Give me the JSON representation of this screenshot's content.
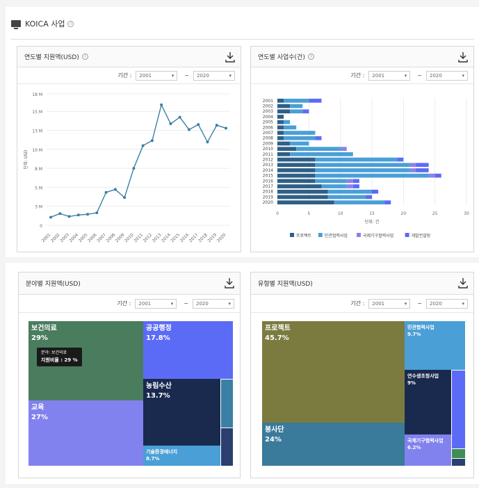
{
  "section": {
    "title": "KOICA 사업"
  },
  "period": {
    "label": "기간 :",
    "from": "2001",
    "to": "2020",
    "sep1": "~",
    "sep2": "~",
    "sep3": "−",
    "sep4": "−"
  },
  "panels": {
    "p1": "연도별 지원액(USD)",
    "p2": "연도별 사업수(건)",
    "p3": "분야별 지원액(USD)",
    "p4": "유형별 지원액(USD)"
  },
  "chart_data": [
    {
      "type": "line",
      "title": "연도별 지원액(USD)",
      "ylabel": "단위: USD",
      "categories": [
        "2001",
        "2002",
        "2003",
        "2004",
        "2005",
        "2006",
        "2007",
        "2008",
        "2009",
        "2010",
        "2011",
        "2012",
        "2013",
        "2014",
        "2015",
        "2016",
        "2017",
        "2018",
        "2019",
        "2020"
      ],
      "values": [
        1.1,
        1.6,
        1.2,
        1.4,
        1.5,
        1.7,
        4.5,
        4.9,
        3.8,
        7.8,
        10.9,
        11.6,
        16.5,
        13.9,
        14.8,
        13.1,
        13.8,
        11.4,
        13.7,
        13.3
      ],
      "yticks": [
        "0",
        "3 M",
        "5 M",
        "8 M",
        "10 M",
        "13 M",
        "15 M",
        "18 M"
      ],
      "ylim": [
        0,
        18
      ]
    },
    {
      "type": "bar",
      "title": "연도별 사업수(건)",
      "xlabel": "단위: 건",
      "categories": [
        "2001",
        "2002",
        "2003",
        "2004",
        "2005",
        "2006",
        "2007",
        "2008",
        "2009",
        "2010",
        "2011",
        "2012",
        "2013",
        "2014",
        "2015",
        "2016",
        "2017",
        "2018",
        "2019",
        "2020"
      ],
      "xticks": [
        "0",
        "5",
        "10",
        "15",
        "20",
        "25",
        "30"
      ],
      "xlim": [
        0,
        30
      ],
      "series": [
        {
          "name": "프로젝트",
          "color": "#2e5f86",
          "values": [
            1,
            2,
            2,
            1,
            1,
            1,
            1,
            1,
            2,
            3,
            2,
            6,
            6,
            6,
            6,
            6,
            7,
            8,
            8,
            9
          ]
        },
        {
          "name": "민관협력사업",
          "color": "#4a9fd6",
          "values": [
            4,
            2,
            2,
            0,
            1,
            2,
            5,
            5,
            3,
            7,
            10,
            13,
            15,
            15,
            18,
            5,
            4,
            7,
            6,
            8
          ]
        },
        {
          "name": "국제기구협력사업",
          "color": "#8b82ea",
          "values": [
            0,
            0,
            0,
            0,
            0,
            0,
            0,
            0,
            0,
            1,
            0,
            0,
            1,
            1,
            1,
            1,
            1,
            0,
            0,
            0
          ]
        },
        {
          "name": "개발컨설팅",
          "color": "#5c6bf5",
          "values": [
            2,
            0,
            1,
            0,
            0,
            0,
            0,
            1,
            0,
            0,
            0,
            1,
            2,
            2,
            1,
            1,
            1,
            1,
            1,
            1
          ]
        }
      ]
    },
    {
      "type": "treemap",
      "title": "분야별 지원액(USD)",
      "items": [
        {
          "name": "보건의료",
          "pct": "29%",
          "color": "#4a7c5e"
        },
        {
          "name": "공공행정",
          "pct": "17.8%",
          "color": "#5c6bf5"
        },
        {
          "name": "교육",
          "pct": "27%",
          "color": "#8182ee"
        },
        {
          "name": "농림수산",
          "pct": "13.7%",
          "color": "#1a2a4e"
        },
        {
          "name": "기술환경에너지",
          "pct": "8.7%",
          "color": "#4a9fd6"
        }
      ],
      "tooltip": {
        "line1": "분야: 보건의료",
        "line2": "지원비율 : 29 %"
      }
    },
    {
      "type": "treemap",
      "title": "유형별 지원액(USD)",
      "items": [
        {
          "name": "프로젝트",
          "pct": "45.7%",
          "color": "#7b7b3f"
        },
        {
          "name": "봉사단",
          "pct": "24%",
          "color": "#3a7a9a"
        },
        {
          "name": "민관협력사업",
          "pct": "9.7%",
          "color": "#4a9fd6"
        },
        {
          "name": "연수생초청사업",
          "pct": "9%",
          "color": "#1a2a4e"
        },
        {
          "name": "국제기구협력사업",
          "pct": "6.2%",
          "color": "#8182ee"
        }
      ]
    }
  ]
}
